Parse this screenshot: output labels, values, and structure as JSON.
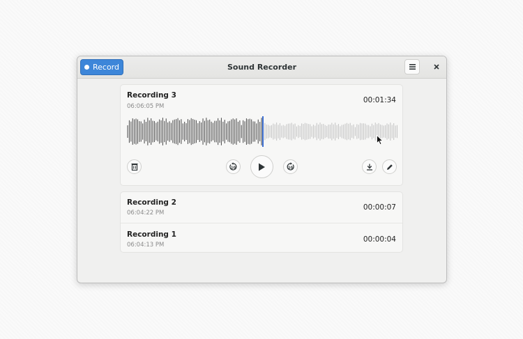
{
  "window": {
    "title": "Sound Recorder"
  },
  "header": {
    "record_label": "Record"
  },
  "active_recording": {
    "name": "Recording 3",
    "created": "06:06:05 PM",
    "duration": "00:01:34"
  },
  "recordings": [
    {
      "name": "Recording 2",
      "created": "06:04:22 PM",
      "duration": "00:00:07"
    },
    {
      "name": "Recording 1",
      "created": "06:04:13 PM",
      "duration": "00:00:04"
    }
  ],
  "controls": {
    "skip_back_seconds": "10",
    "skip_forward_seconds": "10"
  },
  "playback": {
    "progress": 0.5
  },
  "colors": {
    "accent": "#3d86d9",
    "playhead": "#3d6fd1"
  }
}
